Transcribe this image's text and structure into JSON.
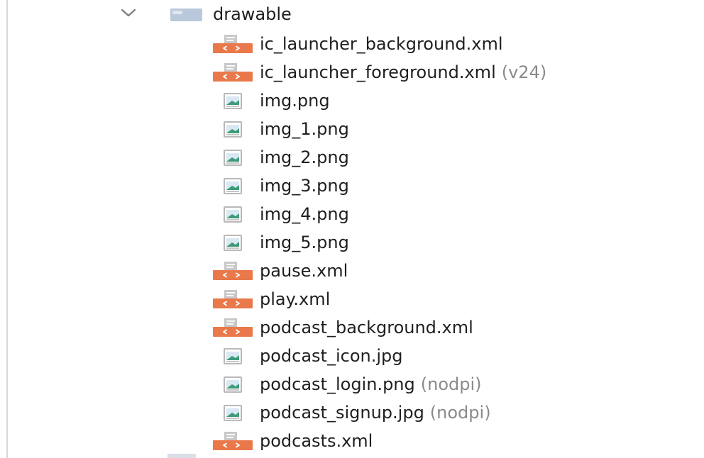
{
  "tree": {
    "folder": {
      "name": "drawable",
      "expanded": true,
      "chevron_icon": "chevron-down-icon",
      "folder_icon": "folder-icon"
    },
    "files": [
      {
        "name": "ic_launcher_background.xml",
        "qualifier": "",
        "type": "xml"
      },
      {
        "name": "ic_launcher_foreground.xml",
        "qualifier": "(v24)",
        "type": "xml"
      },
      {
        "name": "img.png",
        "qualifier": "",
        "type": "image"
      },
      {
        "name": "img_1.png",
        "qualifier": "",
        "type": "image"
      },
      {
        "name": "img_2.png",
        "qualifier": "",
        "type": "image"
      },
      {
        "name": "img_3.png",
        "qualifier": "",
        "type": "image"
      },
      {
        "name": "img_4.png",
        "qualifier": "",
        "type": "image"
      },
      {
        "name": "img_5.png",
        "qualifier": "",
        "type": "image"
      },
      {
        "name": "pause.xml",
        "qualifier": "",
        "type": "xml"
      },
      {
        "name": "play.xml",
        "qualifier": "",
        "type": "xml"
      },
      {
        "name": "podcast_background.xml",
        "qualifier": "",
        "type": "xml"
      },
      {
        "name": "podcast_icon.jpg",
        "qualifier": "",
        "type": "image"
      },
      {
        "name": "podcast_login.png",
        "qualifier": "(nodpi)",
        "type": "image"
      },
      {
        "name": "podcast_signup.jpg",
        "qualifier": "(nodpi)",
        "type": "image"
      },
      {
        "name": "podcasts.xml",
        "qualifier": "",
        "type": "xml"
      }
    ]
  },
  "colors": {
    "text": "#1f1f1f",
    "qualifier_text": "#8a8a8a",
    "xml_icon_accent": "#e9794a",
    "image_icon_accent": "#3f9a7a",
    "folder_icon": "#b9c8da"
  }
}
